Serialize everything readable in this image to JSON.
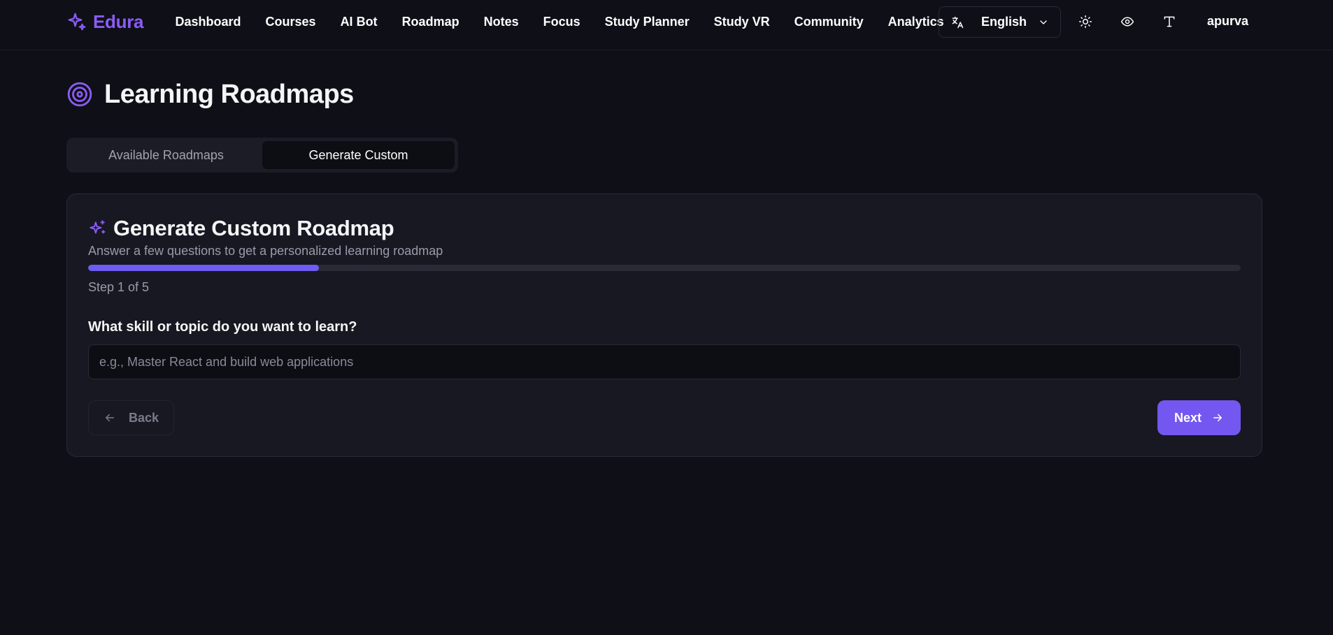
{
  "app": {
    "name": "Edura",
    "brand_color": "#8b5cf6",
    "accent_color": "#7457f0"
  },
  "nav": {
    "links": [
      {
        "label": "Dashboard"
      },
      {
        "label": "Courses"
      },
      {
        "label": "AI Bot"
      },
      {
        "label": "Roadmap"
      },
      {
        "label": "Notes"
      },
      {
        "label": "Focus"
      },
      {
        "label": "Study Planner"
      },
      {
        "label": "Study VR"
      },
      {
        "label": "Community"
      },
      {
        "label": "Analytics"
      }
    ],
    "language": {
      "selected": "English",
      "icon": "translate-icon"
    },
    "icons": [
      "sun-icon",
      "eye-icon",
      "text-size-icon"
    ],
    "user": "apurva"
  },
  "header": {
    "title": "Learning Roadmaps",
    "icon": "target-icon"
  },
  "tabs": [
    {
      "label": "Available Roadmaps",
      "active": false
    },
    {
      "label": "Generate Custom",
      "active": true
    }
  ],
  "card": {
    "title": "Generate Custom Roadmap",
    "icon": "sparkles-icon",
    "subtitle": "Answer a few questions to get a personalized learning roadmap",
    "progress": {
      "current": 1,
      "total": 5,
      "fill_percent": 20
    },
    "step_text": "Step 1 of 5",
    "question": "What skill or topic do you want to learn?",
    "input": {
      "value": "",
      "placeholder": "e.g., Master React and build web applications"
    },
    "back_label": "Back",
    "next_label": "Next"
  }
}
